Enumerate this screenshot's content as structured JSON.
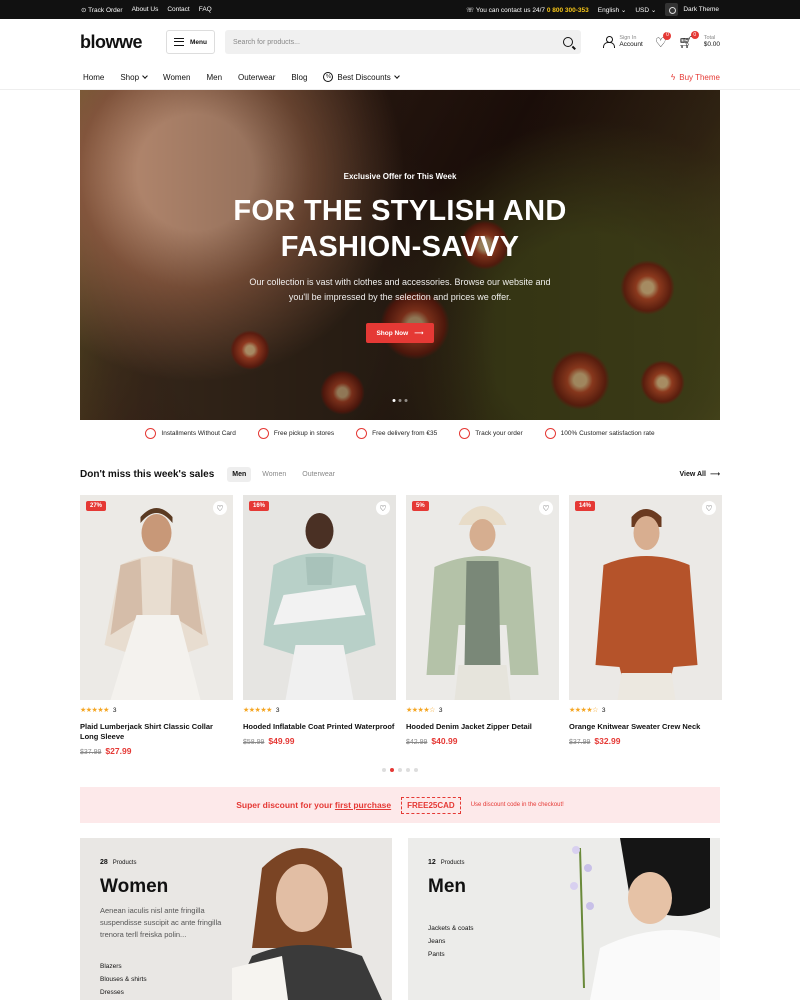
{
  "topbar": {
    "links": [
      "Track Order",
      "About Us",
      "Contact",
      "FAQ"
    ],
    "contact_label": "You can contact us 24/7",
    "phone": "0 800 300-353",
    "language": "English",
    "currency": "USD",
    "theme_toggle": "Dark Theme"
  },
  "header": {
    "logo": "blowwe",
    "menu_label": "Menu",
    "search_placeholder": "Search for products...",
    "signin_label": "Sign In",
    "account_label": "Account",
    "wishlist_count": "0",
    "cart_count": "0",
    "cart_total_label": "Total",
    "cart_total": "$0.00"
  },
  "nav": {
    "items": [
      "Home",
      "Shop",
      "Women",
      "Men",
      "Outerwear",
      "Blog",
      "Best Discounts"
    ],
    "buy_theme": "Buy Theme"
  },
  "hero": {
    "eyebrow": "Exclusive Offer for This Week",
    "title_line1": "FOR THE STYLISH AND",
    "title_line2": "FASHION-SAVVY",
    "subtitle_line1": "Our collection is vast with clothes and accessories. Browse our website and",
    "subtitle_line2": "you'll be impressed by the selection and prices we offer.",
    "cta": "Shop Now",
    "slide_count": 3,
    "active_slide": 0
  },
  "features": [
    "Installments Without Card",
    "Free pickup in stores",
    "Free delivery from €35",
    "Track your order",
    "100% Customer satisfaction rate"
  ],
  "sales": {
    "title": "Don't miss this week's sales",
    "tabs": [
      "Men",
      "Women",
      "Outerwear"
    ],
    "active_tab": "Men",
    "view_all": "View All",
    "products": [
      {
        "discount": "27%",
        "rating": 5,
        "reviews": "3",
        "name": "Plaid Lumberjack Shirt Classic Collar Long Sleeve",
        "old_price": "$37.99",
        "price": "$27.99"
      },
      {
        "discount": "16%",
        "rating": 5,
        "reviews": "3",
        "name": "Hooded Inflatable Coat Printed Waterproof",
        "old_price": "$58.99",
        "price": "$49.99"
      },
      {
        "discount": "5%",
        "rating": 4,
        "reviews": "3",
        "name": "Hooded Denim Jacket Zipper Detail",
        "old_price": "$42.99",
        "price": "$40.99"
      },
      {
        "discount": "14%",
        "rating": 4,
        "reviews": "3",
        "name": "Orange Knitwear Sweater Crew Neck",
        "old_price": "$37.99",
        "price": "$32.99"
      }
    ],
    "page_count": 5,
    "active_page": 1
  },
  "promo": {
    "text_before": "Super discount for your",
    "text_link": "first purchase",
    "code": "FREE25CAD",
    "note": "Use discount code in the checkout!"
  },
  "categories": [
    {
      "count": "28",
      "count_label": "Products",
      "title": "Women",
      "description": "Aenean iaculis nisl ante fringilla suspendisse suscipit ac ante fringilla trenora terll freiska polin...",
      "links": [
        "Blazers",
        "Blouses & shirts",
        "Dresses"
      ]
    },
    {
      "count": "12",
      "count_label": "Products",
      "title": "Men",
      "description": "",
      "links": [
        "Jackets & coats",
        "Jeans",
        "Pants"
      ]
    }
  ],
  "colors": {
    "accent": "#e53935",
    "topbar": "#111111",
    "promo_bg": "#fde9ea",
    "phone": "#f5c518"
  }
}
